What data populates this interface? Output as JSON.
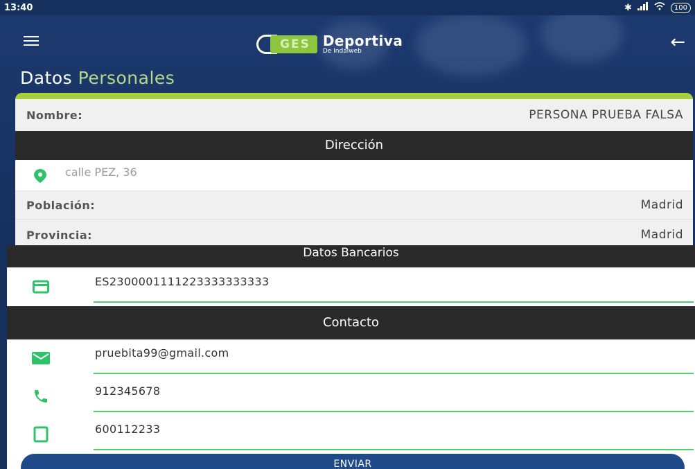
{
  "status_bar": {
    "time": "13:40",
    "battery": "100"
  },
  "app": {
    "logo_ges": "GES",
    "logo_main": "Deportiva",
    "logo_sub": "De Indalweb"
  },
  "page": {
    "title_part1": "Datos ",
    "title_part2": "Personales"
  },
  "personal": {
    "nombre_label": "Nombre:",
    "nombre_value": "PERSONA PRUEBA FALSA"
  },
  "address": {
    "header": "Dirección",
    "street": "calle PEZ, 36",
    "poblacion_label": "Población:",
    "poblacion_value": "Madrid",
    "provincia_label": "Provincia:",
    "provincia_value": "Madrid"
  },
  "bank": {
    "header": "Datos Bancarios",
    "iban": "ES2300001111223333333333"
  },
  "contact": {
    "header": "Contacto",
    "email": "pruebita99@gmail.com",
    "phone": "912345678",
    "mobile": "600112233"
  },
  "actions": {
    "send_label": "ENVIAR"
  },
  "colors": {
    "accent_green": "#a6cf3a",
    "field_underline": "#4cd168",
    "icon_green": "#2fc26a",
    "header_blue": "#1a3668"
  }
}
